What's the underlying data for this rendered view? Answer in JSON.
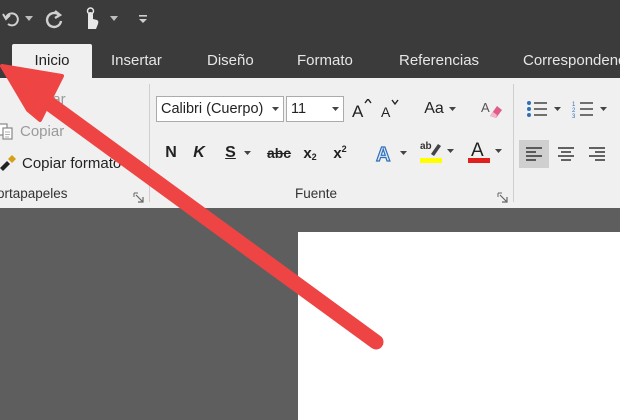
{
  "qat": {
    "icons": [
      "undo-icon",
      "redo-icon",
      "touch-mode-icon",
      "customize-icon"
    ]
  },
  "tabs": [
    {
      "label": "Inicio",
      "active": true
    },
    {
      "label": "Insertar"
    },
    {
      "label": "Diseño"
    },
    {
      "label": "Formato"
    },
    {
      "label": "Referencias"
    },
    {
      "label": "Correspondencia"
    }
  ],
  "clipboard": {
    "cut_label": "Cortar",
    "copy_label": "Copiar",
    "format_painter_label": "Copiar formato",
    "group_label": "Portapapeles"
  },
  "font": {
    "font_name": "Calibri (Cuerpo)",
    "font_size": "11",
    "case_label": "Aa",
    "bold": "N",
    "italic": "K",
    "underline": "S",
    "strikethrough": "abc",
    "subscript": "x",
    "superscript": "x",
    "group_label": "Fuente"
  },
  "colors": {
    "highlight": "#ffff00",
    "font_color": "#e0201c",
    "arrow": "#ee4444",
    "tab_bar": "#3b3b3b",
    "ribbon": "#f0f0f0"
  }
}
